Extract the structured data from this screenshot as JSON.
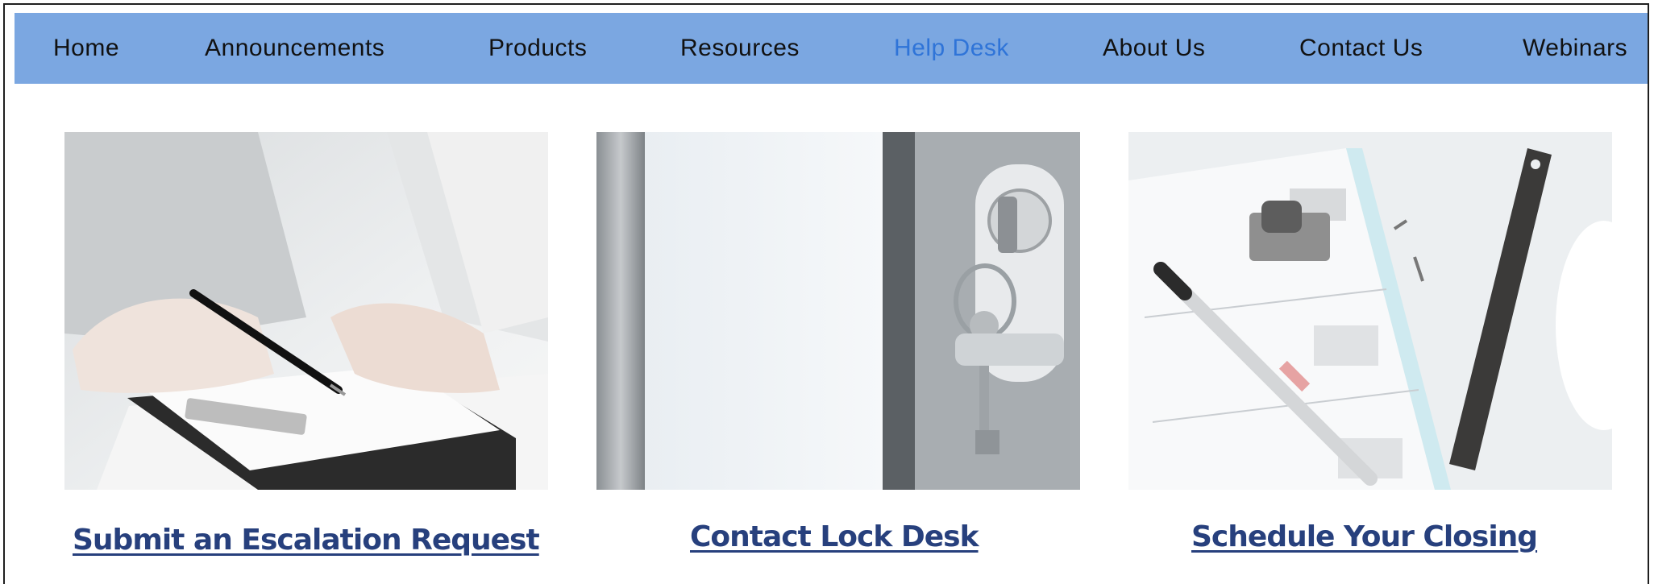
{
  "nav": {
    "items": [
      {
        "label": "Home"
      },
      {
        "label": "Announcements"
      },
      {
        "label": "Products"
      },
      {
        "label": "Resources"
      },
      {
        "label": "Help Desk",
        "active": true
      },
      {
        "label": "About Us"
      },
      {
        "label": "Contact Us"
      },
      {
        "label": "Webinars"
      }
    ],
    "active_color": "#2f74d8",
    "bar_color": "#7ba7e1"
  },
  "cards": [
    {
      "link": "Submit an Escalation Request",
      "image_icon": "signing-document-photo"
    },
    {
      "link": "Contact Lock Desk",
      "image_icon": "key-in-lock-photo"
    },
    {
      "link": "Schedule Your Closing",
      "image_icon": "planner-ruler-pen-photo"
    }
  ],
  "link_color": "#27407d"
}
